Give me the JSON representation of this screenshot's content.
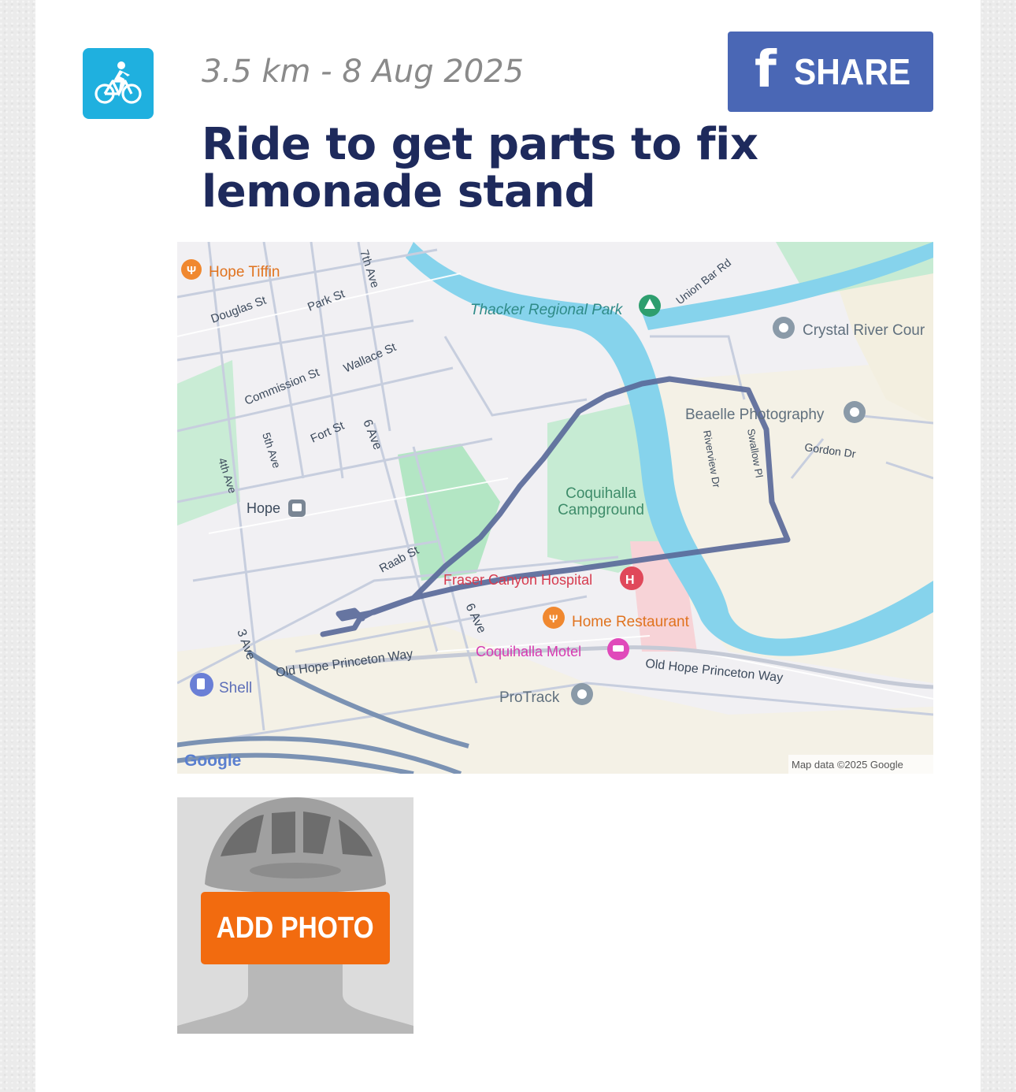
{
  "activity": {
    "type_icon": "bicycle-icon",
    "meta": "3.5 km - 8 Aug 2025",
    "title": "Ride to get parts to fix lemonade stand"
  },
  "share": {
    "icon": "facebook-icon",
    "icon_glyph": "f",
    "label": "SHARE"
  },
  "map": {
    "labels": {
      "hope_tiffin": "Hope Tiffin",
      "douglas_st": "Douglas St",
      "park_st": "Park St",
      "seventh_ave": "7th Ave",
      "thacker_park": "Thacker Regional Park",
      "union_bar_rd": "Union Bar Rd",
      "crystal_river": "Crystal River Cour",
      "commission_st": "Commission St",
      "wallace_st": "Wallace St",
      "beaelle": "Beaelle Photography",
      "fort_st": "Fort St",
      "sixth_ave_a": "6 Ave",
      "fifth_ave": "5th Ave",
      "fourth_ave": "4th Ave",
      "riverview_dr": "Riverview Dr",
      "swallow_pl": "Swallow Pl",
      "gordon_dr": "Gordon Dr",
      "hope": "Hope",
      "coquihalla_campground_1": "Coquihalla",
      "coquihalla_campground_2": "Campground",
      "raab_st": "Raab St",
      "fraser_canyon_hospital": "Fraser Canyon Hospital",
      "sixth_ave_b": "6 Ave",
      "home_restaurant": "Home Restaurant",
      "third_ave": "3 Ave",
      "old_hope_princeton_1": "Old Hope Princeton Way",
      "coquihalla_motel": "Coquihalla Motel",
      "old_hope_princeton_2": "Old Hope Princeton Way",
      "shell": "Shell",
      "protrack": "ProTrack",
      "google": "Google",
      "map_data": "Map data ©2025 Google"
    },
    "colors": {
      "route": "#5a6a9a",
      "water": "#86d3ec",
      "park": "#c6ebd3",
      "land": "#f1f0f3"
    }
  },
  "photo": {
    "placeholder_icon": "helmet-avatar-icon",
    "add_label": "ADD PHOTO"
  }
}
